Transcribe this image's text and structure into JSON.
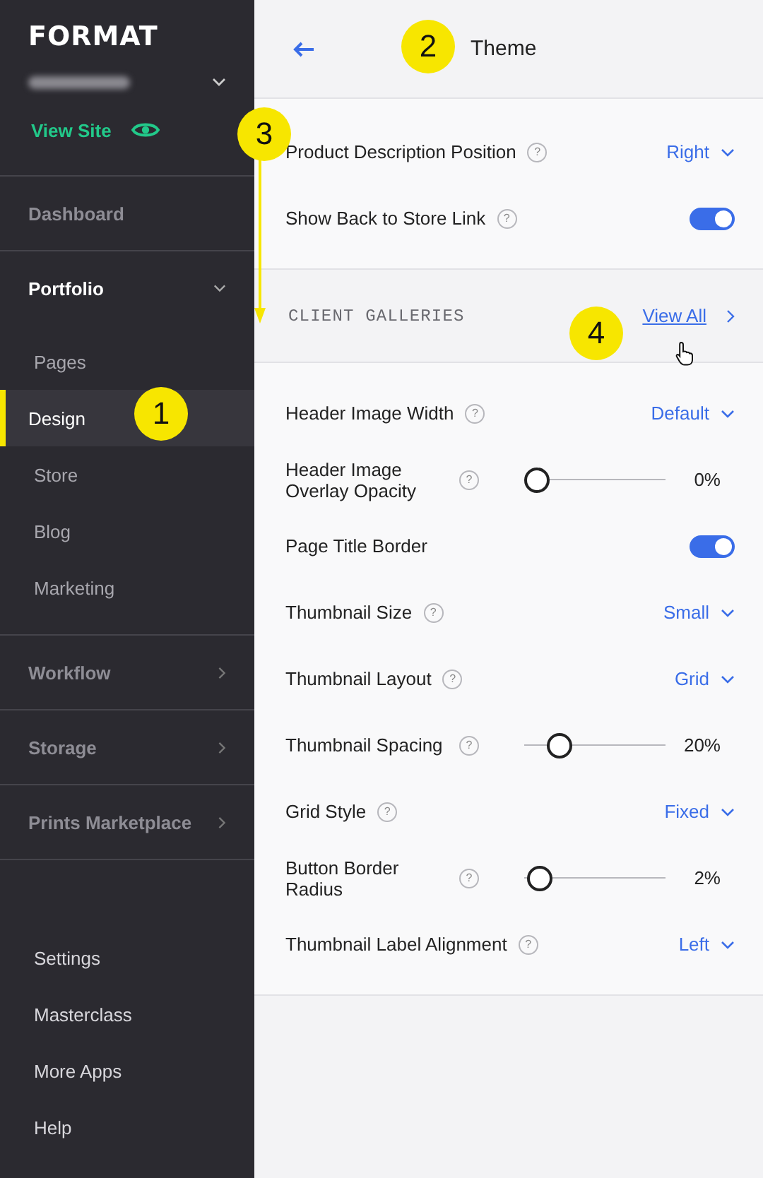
{
  "sidebar": {
    "logo": "FORMAT",
    "view_site": "View Site",
    "sections": [
      {
        "kind": "link",
        "label": "Dashboard"
      },
      {
        "kind": "group",
        "label": "Portfolio",
        "expanded": true,
        "children": [
          {
            "label": "Pages",
            "selected": false
          },
          {
            "label": "Design",
            "selected": true
          },
          {
            "label": "Store",
            "selected": false
          },
          {
            "label": "Blog",
            "selected": false
          },
          {
            "label": "Marketing",
            "selected": false
          }
        ]
      },
      {
        "kind": "group",
        "label": "Workflow",
        "expanded": false
      },
      {
        "kind": "group",
        "label": "Storage",
        "expanded": false
      },
      {
        "kind": "group",
        "label": "Prints Marketplace",
        "expanded": false
      }
    ],
    "footer_links": [
      "Settings",
      "Masterclass",
      "More Apps",
      "Help"
    ]
  },
  "header": {
    "title": "Theme"
  },
  "store_settings": [
    {
      "kind": "dropdown",
      "label": "Product Description Position",
      "help": "?",
      "value": "Right"
    },
    {
      "kind": "toggle",
      "label": "Show Back to Store Link",
      "help": "?",
      "on": true
    }
  ],
  "client_galleries": {
    "heading": "CLIENT GALLERIES",
    "link": "View All",
    "settings": [
      {
        "kind": "dropdown",
        "label": "Header Image Width",
        "help": "?",
        "value": "Default"
      },
      {
        "kind": "slider",
        "label": "Header Image Overlay Opacity",
        "help": "?",
        "level": 0,
        "reading": "0%"
      },
      {
        "kind": "toggle",
        "label": "Page Title Border",
        "on": true
      },
      {
        "kind": "dropdown",
        "label": "Thumbnail Size",
        "help": "?",
        "value": "Small"
      },
      {
        "kind": "dropdown",
        "label": "Thumbnail Layout",
        "help": "?",
        "value": "Grid"
      },
      {
        "kind": "slider",
        "label": "Thumbnail Spacing",
        "help": "?",
        "level": 0.2,
        "reading": "20%"
      },
      {
        "kind": "dropdown",
        "label": "Grid Style",
        "help": "?",
        "value": "Fixed"
      },
      {
        "kind": "slider",
        "label": "Button Border Radius",
        "help": "?",
        "level": 0.02,
        "reading": "2%"
      },
      {
        "kind": "dropdown",
        "label": "Thumbnail Label Alignment",
        "help": "?",
        "value": "Left"
      }
    ]
  },
  "annotations": [
    "1",
    "2",
    "3",
    "4"
  ]
}
